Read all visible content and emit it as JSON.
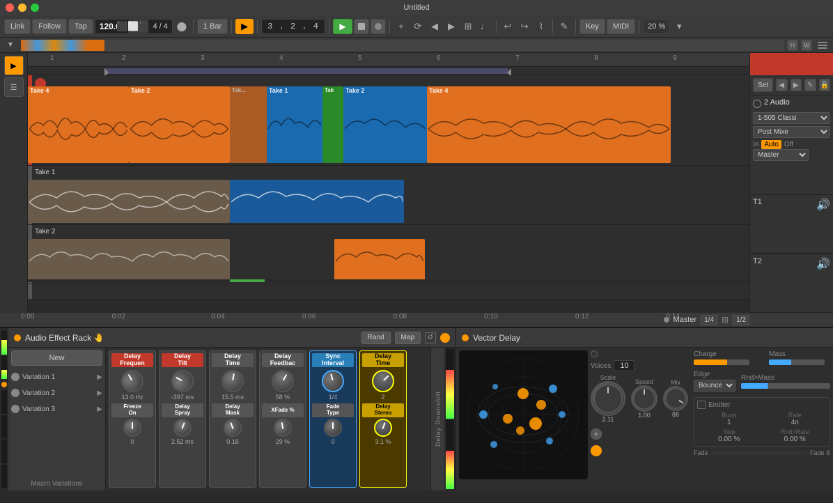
{
  "app": {
    "title": "Untitled"
  },
  "titlebar": {
    "title": "Untitled"
  },
  "toolbar": {
    "link_label": "Link",
    "follow_label": "Follow",
    "tap_label": "Tap",
    "bpm": "120.00",
    "time_sig": "4 / 4",
    "loop_label": "1 Bar",
    "position": "3 . 2 . 4",
    "key_label": "Key",
    "midi_label": "MIDI",
    "zoom_label": "20 %"
  },
  "overview": {
    "h_label": "H",
    "w_label": "W"
  },
  "ruler": {
    "marks": [
      "1",
      "2",
      "3",
      "4",
      "5",
      "6",
      "7",
      "8",
      "9"
    ]
  },
  "tracks": {
    "main_label": "2 Audio",
    "t1_label": "Take 1",
    "t1_id": "T1",
    "t2_label": "Take 2",
    "t2_id": "T2"
  },
  "arrangement_right": {
    "set_label": "Set",
    "preset": "1-505 Classi",
    "post_mix": "Post Mixe",
    "in_label": "In",
    "auto_label": "Auto",
    "off_label": "Off",
    "master_label": "Master"
  },
  "timecodes": {
    "t1": "0:00",
    "t2": "0:02",
    "t3": "0:04",
    "t4": "0:06",
    "t5": "0:08",
    "t6": "0:10",
    "t7": "0:12",
    "t8": "0:14"
  },
  "master_row": {
    "label": "Master",
    "fraction": "1/2",
    "fraction2": "1/4"
  },
  "effect_rack": {
    "title": "Audio Effect Rack 🤚",
    "rand_label": "Rand",
    "map_label": "Map",
    "new_label": "New",
    "macro_label": "Macro Variations",
    "variations": [
      {
        "label": "Variation 1"
      },
      {
        "label": "Variation 2"
      },
      {
        "label": "Variation 3"
      }
    ],
    "delay_downshift": "Delay Downshift",
    "effects": [
      {
        "name": "Delay\nFrequen",
        "style": "red",
        "value": "13.0 Hz",
        "value2": "0"
      },
      {
        "name": "Delay\nTilt",
        "style": "red",
        "value": "-397 ms",
        "value2": "2.52 ms"
      },
      {
        "name": "Delay\nTime",
        "style": "gray",
        "value": "15.5 ms",
        "value2": "0.16"
      },
      {
        "name": "Delay\nFeedbac",
        "style": "gray",
        "value": "58 %",
        "value2": "29 %"
      },
      {
        "name": "Sync\nInterval",
        "style": "blue",
        "value": "1/4",
        "value2": "0"
      },
      {
        "name": "Delay\nTime",
        "style": "yellow",
        "value": "2",
        "value2": "3.1 %"
      }
    ],
    "effect_labels_row2": [
      "Freeze\nOn",
      "Delay\nSpray",
      "Delay\nMask",
      "XFade %",
      "Fade\nType",
      "Delay\nStereo"
    ]
  },
  "vector_delay": {
    "title": "Vector Delay",
    "voices_label": "Voices",
    "voices_value": "10",
    "scale_label": "Scale",
    "scale_value": "2.11",
    "speed_label": "Speed",
    "speed_value": "1.00",
    "mix_label": "Mix",
    "mix_value": "88",
    "charge_label": "Charge",
    "mass_label": "Mass",
    "edge_label": "Edge",
    "edge_value": "Bounce",
    "rnd_mass_label": "Rnd>Mass",
    "emitter_label": "Emitter",
    "burst_label": "Burst",
    "burst_value": "1",
    "rate_label": "Rate",
    "rate_value": "4n",
    "skip_label": "Skip",
    "skip_value": "0.00 %",
    "rnd_rate_label": "Rnd>Rate",
    "rnd_rate_value": "0.00 %",
    "fade_label": "Fade",
    "fade_s_label": "Fade S"
  }
}
